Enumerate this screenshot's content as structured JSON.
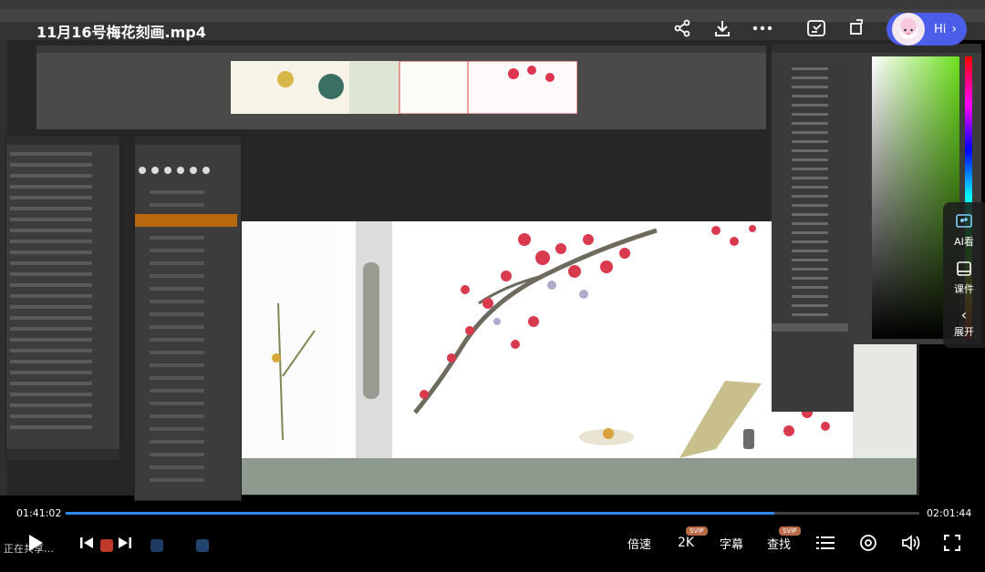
{
  "video": {
    "title": "11月16号梅花刻画.mp4",
    "current_time": "01:41:02",
    "total_time": "02:01:44",
    "progress": 0.83
  },
  "top_bar": {
    "icons": [
      "share-icon",
      "download-icon",
      "more-icon",
      "screen-capture-icon",
      "rotate-icon"
    ],
    "ai_assistant": {
      "label": "Hi",
      "icon": "avatar-icon"
    }
  },
  "side_dock": {
    "items": [
      {
        "label": "AI看",
        "icon": "ai-look-icon"
      },
      {
        "label": "课件",
        "icon": "courseware-icon"
      },
      {
        "label": "展开",
        "icon": "chevron-left-icon"
      }
    ]
  },
  "controls": {
    "speed_label": "倍速",
    "quality_label": "2K",
    "quality_badge": "SVIP",
    "subtitle_label": "字幕",
    "search_label": "查找",
    "search_badge": "SVIP"
  },
  "taskbar": {
    "text": "正在共享…"
  },
  "colors": {
    "progress": "#2d8cf0",
    "ai_pill": "#4b5eea",
    "svip_badge": "#b86a46"
  }
}
